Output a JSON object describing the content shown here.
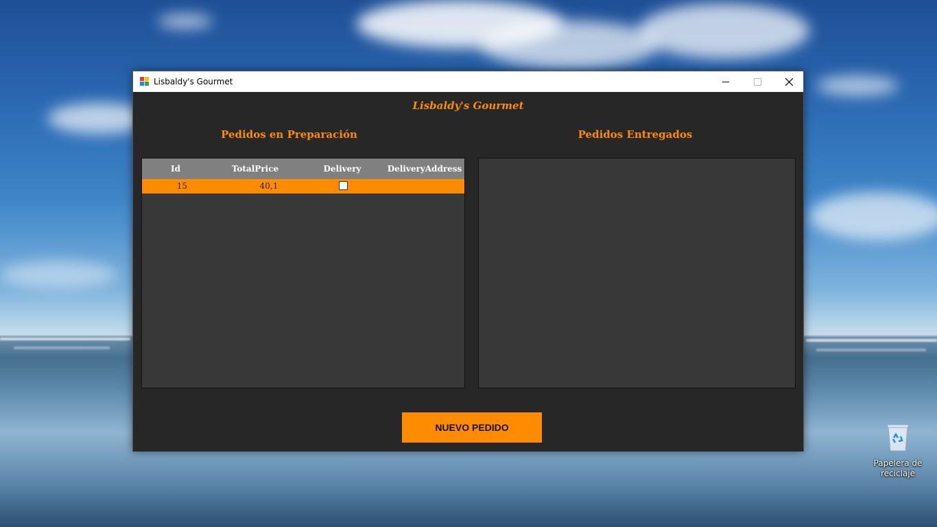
{
  "window": {
    "title": "Lisbaldy's Gourmet",
    "controls": {
      "minimize": "—",
      "maximize": "☐",
      "close": "✕"
    }
  },
  "app": {
    "heading": "Lisbaldy's Gourmet",
    "sections": {
      "preparation": "Pedidos en Preparación",
      "delivered": "Pedidos Entregados"
    },
    "preparation_table": {
      "columns": [
        "Id",
        "TotalPrice",
        "Delivery",
        "DeliveryAddress"
      ],
      "rows": [
        {
          "id": "15",
          "total_price": "40,1",
          "delivery": false,
          "delivery_address": ""
        }
      ]
    },
    "new_order_button": "NUEVO PEDIDO"
  },
  "desktop": {
    "recycle_bin_label": "Papelera de reciclaje"
  },
  "colors": {
    "accent": "#ff8c00",
    "window_bg": "#272727",
    "grid_bg": "#383838",
    "grid_header": "#808080"
  }
}
